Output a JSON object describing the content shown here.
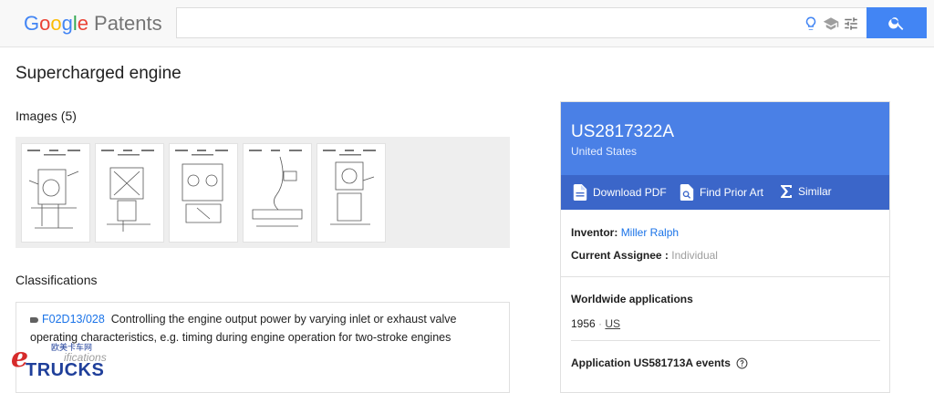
{
  "header": {
    "logo_google": [
      "G",
      "o",
      "o",
      "g",
      "l",
      "e"
    ],
    "logo_product": "Patents",
    "search_value": "",
    "search_placeholder": ""
  },
  "page": {
    "title": "Supercharged engine"
  },
  "images": {
    "heading": "Images (5)",
    "count": 5
  },
  "classifications": {
    "heading": "Classifications",
    "code": "F02D13/028",
    "description": "Controlling the engine output power by varying inlet or exhaust valve operating characteristics, e.g. timing during engine operation for two-stroke engines",
    "more": "ifications"
  },
  "patent": {
    "number": "US2817322A",
    "country": "United States",
    "actions": {
      "download": "Download PDF",
      "prior_art": "Find Prior Art",
      "similar": "Similar"
    },
    "inventor_label": "Inventor:",
    "inventor": "Miller Ralph",
    "assignee_label": "Current Assignee :",
    "assignee": "Individual",
    "worldwide_heading": "Worldwide applications",
    "worldwide_year": "1956",
    "worldwide_sep": "·",
    "worldwide_country": "US",
    "events_heading": "Application US581713A events"
  },
  "watermark": {
    "cn": "欧美卡车网",
    "brand": "TRUCKS"
  },
  "colors": {
    "accent": "#4285f4",
    "card_head": "#4a80e6",
    "card_bar": "#3b66c9",
    "link": "#1a73e8"
  }
}
